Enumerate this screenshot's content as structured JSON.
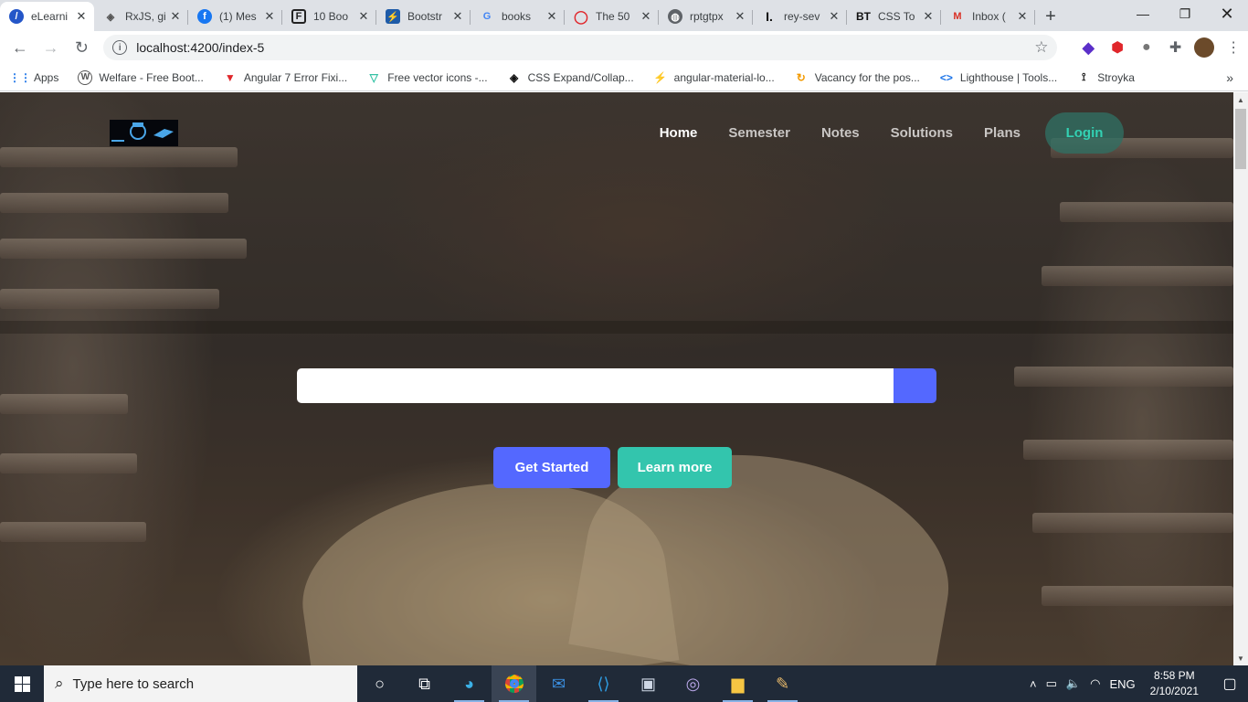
{
  "browser": {
    "tabs": [
      {
        "title": "eLearni",
        "icon": "elearning-favicon",
        "active": true
      },
      {
        "title": "RxJS, gi",
        "icon": "rxjs-favicon"
      },
      {
        "title": "(1) Mes",
        "icon": "facebook-favicon"
      },
      {
        "title": "10 Boo",
        "icon": "flaticon-favicon"
      },
      {
        "title": "Bootstr",
        "icon": "bootstrap-favicon"
      },
      {
        "title": "books",
        "icon": "google-favicon"
      },
      {
        "title": "The 50",
        "icon": "opera-favicon"
      },
      {
        "title": "rptgtpx",
        "icon": "globe-favicon"
      },
      {
        "title": "rey-sev",
        "icon": "indeed-favicon"
      },
      {
        "title": "CSS To",
        "icon": "bt-favicon"
      },
      {
        "title": "Inbox (",
        "icon": "gmail-favicon"
      }
    ],
    "address": "localhost:4200/index-5",
    "bookmarks": [
      {
        "label": "Apps",
        "icon": "apps-grid-icon"
      },
      {
        "label": "Welfare - Free Boot...",
        "icon": "wordpress-icon"
      },
      {
        "label": "Angular 7 Error Fixi...",
        "icon": "vuetify-icon"
      },
      {
        "label": "Free vector icons -...",
        "icon": "vector-icon"
      },
      {
        "label": "CSS Expand/Collap...",
        "icon": "codepen-icon"
      },
      {
        "label": "angular-material-lo...",
        "icon": "lightning-icon"
      },
      {
        "label": "Vacancy for the pos...",
        "icon": "sync-icon"
      },
      {
        "label": "Lighthouse | Tools...",
        "icon": "code-icon"
      },
      {
        "label": "Stroyka",
        "icon": "stroyka-icon"
      }
    ]
  },
  "page": {
    "nav": [
      {
        "label": "Home",
        "active": true
      },
      {
        "label": "Semester"
      },
      {
        "label": "Notes"
      },
      {
        "label": "Solutions"
      },
      {
        "label": "Plans"
      }
    ],
    "login_label": "Login",
    "search": {
      "value": "",
      "placeholder": ""
    },
    "cta_primary": "Get Started",
    "cta_secondary": "Learn more",
    "colors": {
      "primary": "#5468ff",
      "secondary": "#33c5ad",
      "login_text": "#33d1b3"
    }
  },
  "taskbar": {
    "search_placeholder": "Type here to search",
    "language": "ENG",
    "time": "8:58 PM",
    "date": "2/10/2021"
  }
}
